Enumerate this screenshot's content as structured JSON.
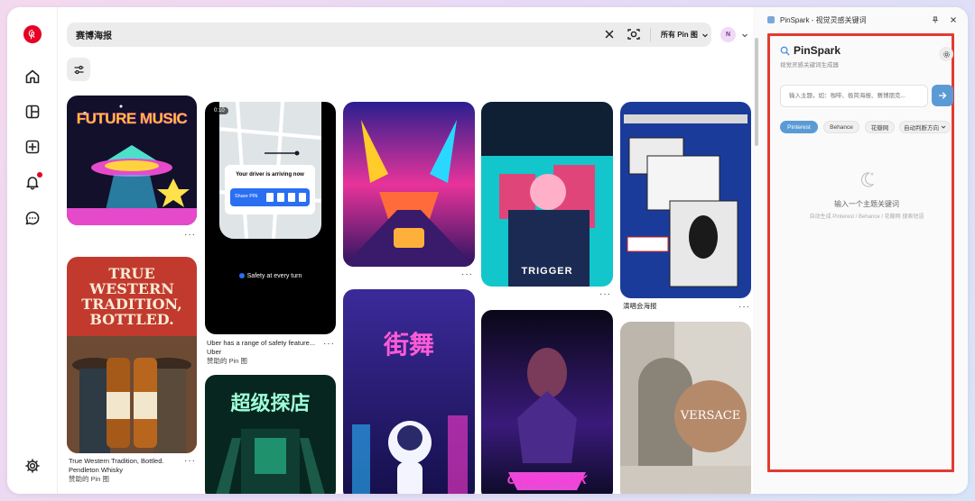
{
  "colors": {
    "pinterest_red": "#e60023",
    "accent_blue": "#4a90e2",
    "chip_active": "#5b9bd5",
    "highlight_red": "#e33b33",
    "avatar_bg": "#f1d8f7"
  },
  "nav": {
    "items": [
      {
        "icon": "home-icon"
      },
      {
        "icon": "boards-icon"
      },
      {
        "icon": "create-icon"
      },
      {
        "icon": "notifications-icon"
      },
      {
        "icon": "messages-icon"
      },
      {
        "icon": "settings-icon"
      }
    ]
  },
  "search": {
    "query": "赛博海报",
    "scope_label": "所有 Pin 图"
  },
  "account": {
    "avatar_initial": "N"
  },
  "pins": {
    "col2_top": {
      "caption": "Your driver is arriving now",
      "share_label": "Share PIN",
      "timer": "0:10",
      "safety": "Safety at every turn"
    },
    "uber": {
      "title": "Uber has a range of safety feature...",
      "brand": "Uber",
      "sponsor": "赞助的 Pin 图"
    },
    "whisky": {
      "title": "True Western Tradition, Bottled.",
      "brand": "Pendleton Whisky",
      "sponsor": "赞助的 Pin 图"
    },
    "concert": {
      "title": "演唱会海报"
    },
    "poster_texts": {
      "future_music": "FUTURE MUSIC",
      "whisky_ad": "TRUE WESTERN TRADITION, BOTTLED.",
      "store": "超级探店",
      "trigger": "TRIGGER",
      "street_dance": "街舞",
      "cyberpunk": "CYBERPUNK",
      "versace": "VERSACE"
    }
  },
  "panel": {
    "window_title": "PinSpark - 视觉灵感关键词",
    "brand": "PinSpark",
    "subtitle": "视觉灵感关键词生成器",
    "input_placeholder": "输入主题，如：咖啡、极简海报、赛博朋克...",
    "chips": [
      {
        "label": "Pinterest",
        "active": true
      },
      {
        "label": "Behance",
        "active": false
      },
      {
        "label": "花瓣网",
        "active": false
      },
      {
        "label": "自动判断方向",
        "active": false
      }
    ],
    "empty_title": "输入一个主题关键词",
    "empty_sub": "自动生成 Pinterest / Behance / 花瓣网 搜索短语"
  }
}
